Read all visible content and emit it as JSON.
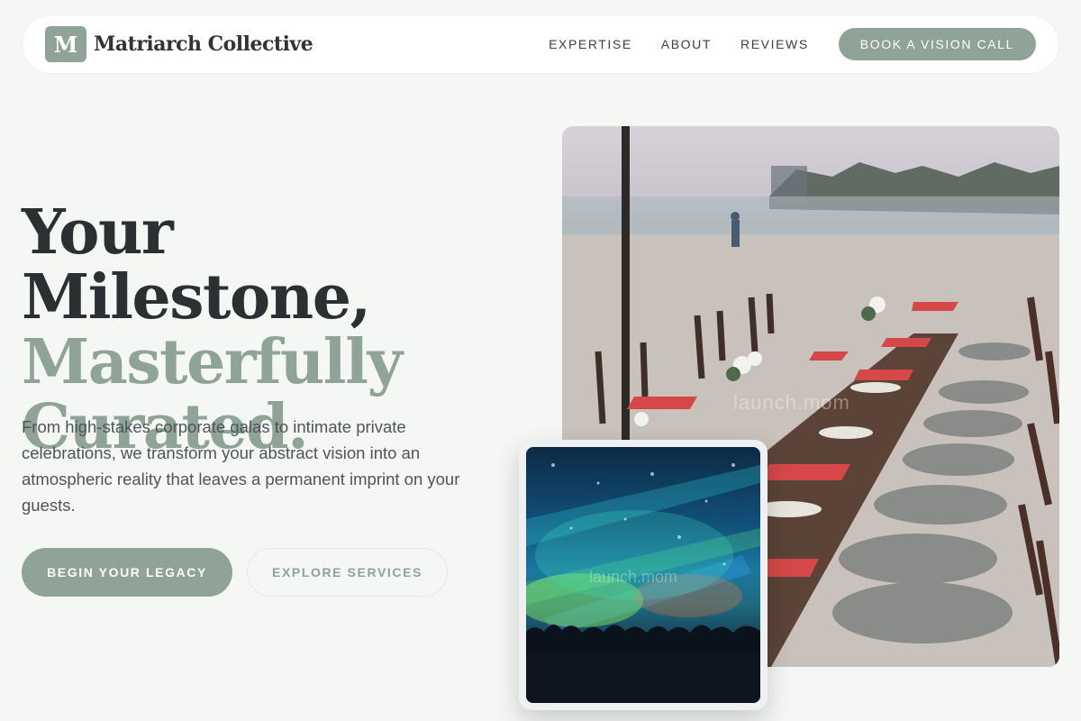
{
  "header": {
    "logo_letter": "M",
    "brand_name": "Matriarch Collective",
    "nav": [
      "EXPERTISE",
      "ABOUT",
      "REVIEWS"
    ],
    "cta_label": "BOOK A VISION CALL"
  },
  "hero": {
    "title_line1": "Your Milestone,",
    "title_line2": "Masterfully",
    "title_line3": "Curated.",
    "description": "From high-stakes corporate galas to intimate private celebrations, we transform your abstract vision into an atmospheric reality that leaves a permanent imprint on your guests.",
    "primary_button": "BEGIN YOUR LEGACY",
    "secondary_button": "EXPLORE SERVICES"
  },
  "images": {
    "main_watermark": "launch.mom",
    "inset_watermark": "launch.mom"
  },
  "colors": {
    "accent": "#8fa396",
    "heading": "#2b3033",
    "background": "#f5f7f5"
  }
}
